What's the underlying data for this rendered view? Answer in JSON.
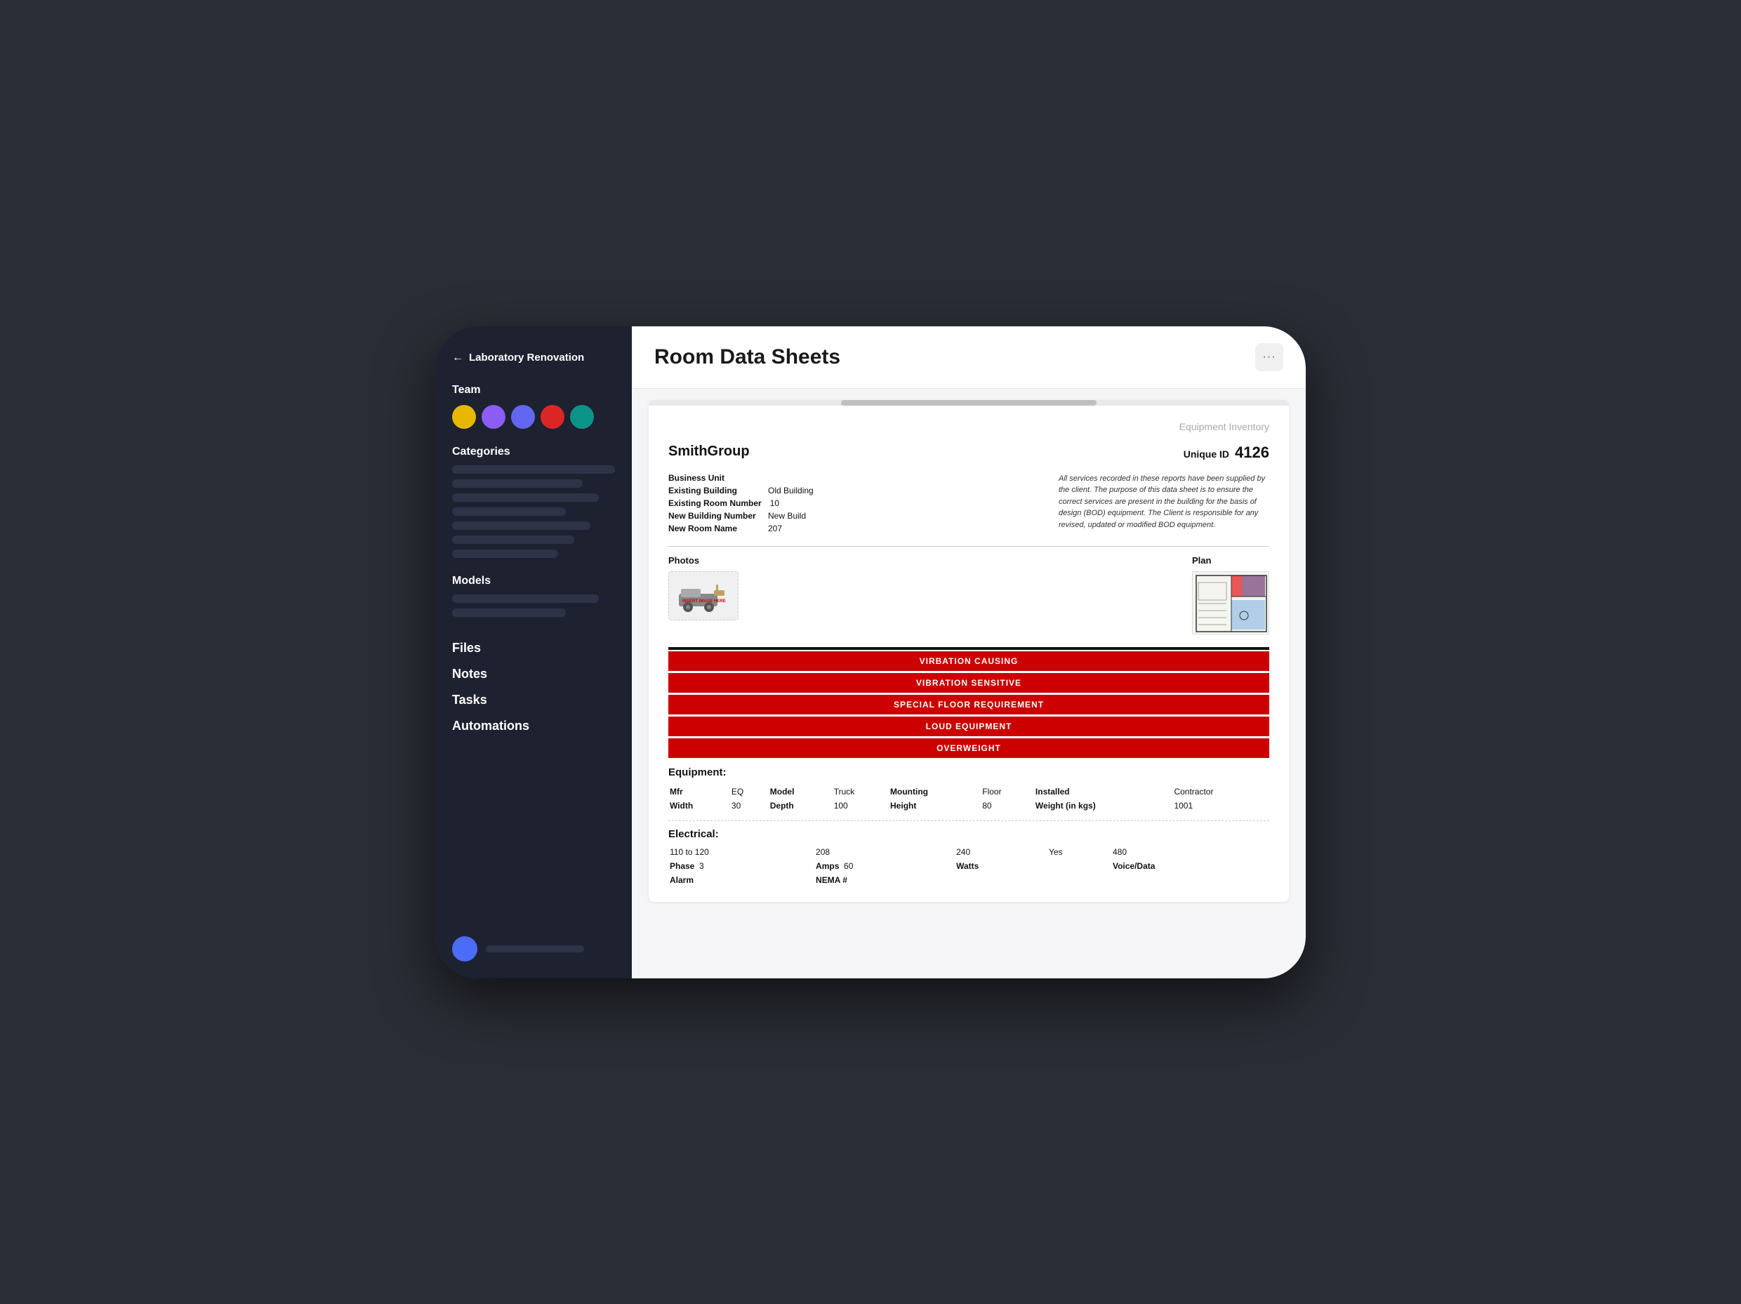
{
  "app": {
    "back_label": "← Laboratory Renovation",
    "more_icon": "···"
  },
  "sidebar": {
    "back_label": "Laboratory Renovation",
    "team_label": "Team",
    "categories_label": "Categories",
    "models_label": "Models",
    "nav_items": [
      "Files",
      "Notes",
      "Tasks",
      "Automations"
    ],
    "avatars": [
      {
        "color": "#e8b800",
        "label": "yellow-avatar"
      },
      {
        "color": "#8b5cf6",
        "label": "purple-avatar"
      },
      {
        "color": "#6366f1",
        "label": "blue-avatar"
      },
      {
        "color": "#dc2626",
        "label": "red-avatar"
      },
      {
        "color": "#0d9488",
        "label": "teal-avatar"
      }
    ]
  },
  "page": {
    "title": "Room Data Sheets",
    "more_btn": "···"
  },
  "sheet": {
    "eq_inventory_label": "Equipment Inventory",
    "company": "SmithGroup",
    "unique_id_label": "Unique ID",
    "unique_id_value": "4126",
    "fields": [
      {
        "key": "Business Unit",
        "value": ""
      },
      {
        "key": "Existing Building",
        "value": "Old Building"
      },
      {
        "key": "Existing Room Number",
        "value": "10"
      },
      {
        "key": "New Building Number",
        "value": "New Build"
      },
      {
        "key": "New Room Name",
        "value": "207"
      }
    ],
    "disclaimer": "All services recorded in these reports have been supplied by the client. The purpose of this data sheet is to ensure the correct services are present in the building for the basis of design (BOD) equipment. The Client is responsible for any revised, updated or modified BOD equipment.",
    "photos_label": "Photos",
    "plan_label": "Plan",
    "alerts": [
      "VIRBATION CAUSING",
      "VIBRATION SENSITIVE",
      "SPECIAL FLOOR REQUIREMENT",
      "LOUD EQUIPMENT",
      "OVERWEIGHT"
    ],
    "equipment_label": "Equipment:",
    "eq_rows": [
      [
        {
          "label": "Mfr",
          "value": "EQ"
        },
        {
          "label": "Model",
          "value": "Truck"
        },
        {
          "label": "Mounting",
          "value": "Floor"
        },
        {
          "label": "Installed",
          "value": "Contractor"
        }
      ],
      [
        {
          "label": "Width",
          "value": "30"
        },
        {
          "label": "Depth",
          "value": "100"
        },
        {
          "label": "Height",
          "value": "80"
        },
        {
          "label": "Weight (in kgs)",
          "value": "1001"
        }
      ]
    ],
    "electrical_label": "Electrical:",
    "el_rows": [
      [
        {
          "label": "",
          "value": "110 to 120"
        },
        {
          "label": "",
          "value": "208"
        },
        {
          "label": "",
          "value": "240"
        },
        {
          "label": "",
          "value": "Yes"
        },
        {
          "label": "",
          "value": "480"
        }
      ],
      [
        {
          "label": "Phase",
          "value": "3"
        },
        {
          "label": "Amps",
          "value": "60"
        },
        {
          "label": "Watts",
          "value": ""
        },
        {
          "label": "",
          "value": ""
        },
        {
          "label": "Voice/Data",
          "value": ""
        }
      ],
      [
        {
          "label": "Alarm",
          "value": ""
        },
        {
          "label": "NEMA #",
          "value": ""
        },
        {
          "label": "",
          "value": ""
        },
        {
          "label": "",
          "value": ""
        },
        {
          "label": "",
          "value": ""
        }
      ]
    ]
  }
}
